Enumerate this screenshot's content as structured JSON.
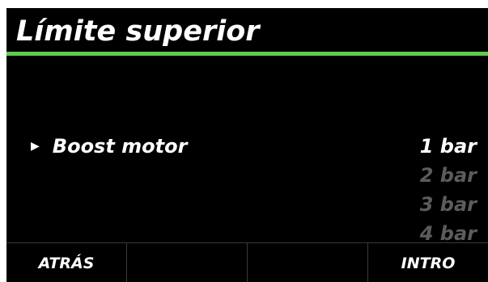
{
  "header": {
    "title": "Límite superior",
    "accent_color": "#5ecb4f"
  },
  "menu": {
    "selected_icon": "right-triangle-arrow-icon",
    "item_label": "Boost motor"
  },
  "options": [
    {
      "label": "1 bar",
      "selected": true
    },
    {
      "label": "2 bar",
      "selected": false
    },
    {
      "label": "3 bar",
      "selected": false
    },
    {
      "label": "4 bar",
      "selected": false
    }
  ],
  "softkeys": [
    {
      "label": "ATRÁS"
    },
    {
      "label": ""
    },
    {
      "label": ""
    },
    {
      "label": "INTRO"
    }
  ]
}
